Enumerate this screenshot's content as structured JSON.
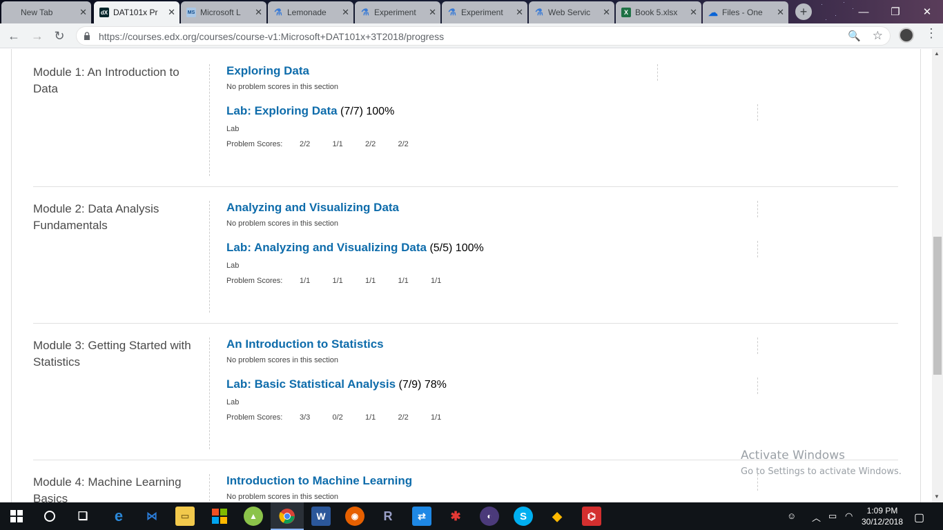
{
  "browser": {
    "tabs": [
      {
        "title": "New Tab",
        "icon": "blank-icon",
        "active": false
      },
      {
        "title": "DAT101x Pr",
        "icon": "edx-icon",
        "active": true
      },
      {
        "title": "Microsoft L",
        "icon": "microsoft-learn-icon",
        "active": false
      },
      {
        "title": "Lemonade",
        "icon": "flask-icon",
        "active": false
      },
      {
        "title": "Experiment",
        "icon": "flask-icon",
        "active": false
      },
      {
        "title": "Experiment",
        "icon": "flask-icon",
        "active": false
      },
      {
        "title": "Web Servic",
        "icon": "flask-icon",
        "active": false
      },
      {
        "title": "Book 5.xlsx",
        "icon": "excel-icon",
        "active": false
      },
      {
        "title": "Files - One",
        "icon": "onedrive-icon",
        "active": false
      }
    ],
    "new_tab_label": "+",
    "url": "https://courses.edx.org/courses/course-v1:Microsoft+DAT101x+3T2018/progress"
  },
  "progress": {
    "chapters": [
      {
        "title": "Module 1: An Introduction to Data",
        "section": {
          "title": "Exploring Data",
          "note": "No problem scores in this section"
        },
        "lab": {
          "title": "Lab: Exploring Data",
          "score": "(7/7) 100%",
          "type": "Lab",
          "scores_label": "Problem Scores:",
          "scores": [
            "2/2",
            "1/1",
            "2/2",
            "2/2"
          ]
        }
      },
      {
        "title": "Module 2: Data Analysis Fundamentals",
        "section": {
          "title": "Analyzing and Visualizing Data",
          "note": "No problem scores in this section"
        },
        "lab": {
          "title": "Lab: Analyzing and Visualizing Data",
          "score": "(5/5) 100%",
          "type": "Lab",
          "scores_label": "Problem Scores:",
          "scores": [
            "1/1",
            "1/1",
            "1/1",
            "1/1",
            "1/1"
          ]
        }
      },
      {
        "title": "Module 3: Getting Started with Statistics",
        "section": {
          "title": "An Introduction to Statistics",
          "note": "No problem scores in this section"
        },
        "lab": {
          "title": "Lab: Basic Statistical Analysis",
          "score": "(7/9) 78%",
          "type": "Lab",
          "scores_label": "Problem Scores:",
          "scores": [
            "3/3",
            "0/2",
            "1/1",
            "2/2",
            "1/1"
          ]
        }
      },
      {
        "title": "Module 4: Machine Learning Basics",
        "section": {
          "title": "Introduction to Machine Learning",
          "note": "No problem scores in this section"
        }
      }
    ]
  },
  "watermark": {
    "line1": "Activate Windows",
    "line2": "Go to Settings to activate Windows."
  },
  "taskbar": {
    "time": "1:09 PM",
    "date": "30/12/2018"
  },
  "colors": {
    "link": "#0e6cab",
    "taskbar": "#101418",
    "tab_active": "#f1f3f4"
  }
}
